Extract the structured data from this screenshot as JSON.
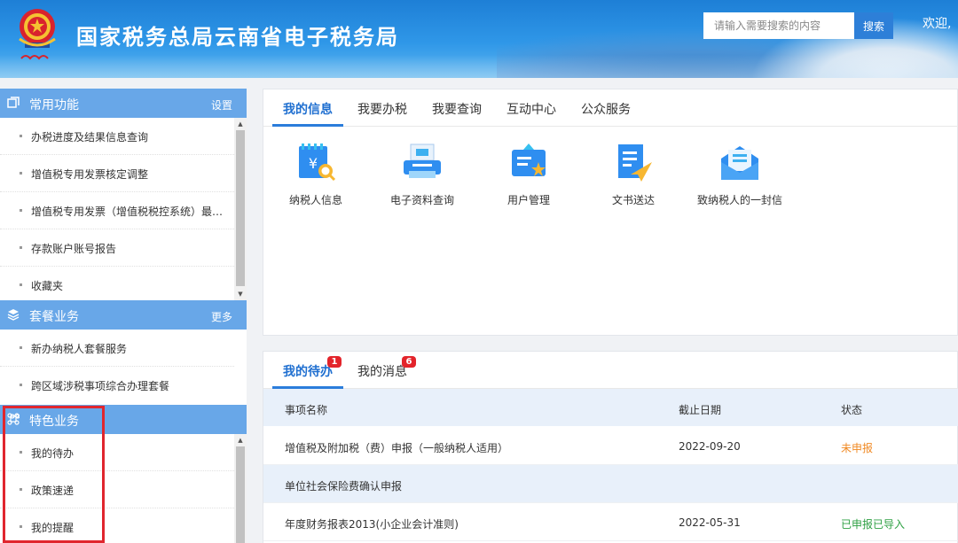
{
  "header": {
    "site_title": "国家税务总局云南省电子税务局",
    "search_placeholder": "请输入需要搜索的内容",
    "search_button": "搜索",
    "welcome_text": "欢迎,"
  },
  "sidebar": {
    "sections": [
      {
        "title": "常用功能",
        "action": "设置",
        "icon": "copy-icon",
        "items": [
          "办税进度及结果信息查询",
          "增值税专用发票核定调整",
          "增值税专用发票（增值税税控系统）最高开票限额申请",
          "存款账户账号报告",
          "收藏夹"
        ]
      },
      {
        "title": "套餐业务",
        "action": "更多",
        "icon": "layers-icon",
        "items": [
          "新办纳税人套餐服务",
          "跨区域涉税事项综合办理套餐"
        ]
      },
      {
        "title": "特色业务",
        "action": "",
        "icon": "command-icon",
        "items": [
          "我的待办",
          "政策速递",
          "我的提醒"
        ]
      }
    ]
  },
  "main_tabs": [
    "我的信息",
    "我要办税",
    "我要查询",
    "互动中心",
    "公众服务"
  ],
  "apps": [
    {
      "label": "纳税人信息",
      "icon": "taxpayer-info-icon"
    },
    {
      "label": "电子资料查询",
      "icon": "e-document-query-icon"
    },
    {
      "label": "用户管理",
      "icon": "user-management-icon"
    },
    {
      "label": "文书送达",
      "icon": "document-delivery-icon"
    },
    {
      "label": "致纳税人的一封信",
      "icon": "letter-icon"
    }
  ],
  "todo": {
    "tabs": [
      {
        "label": "我的待办",
        "badge": "1"
      },
      {
        "label": "我的消息",
        "badge": "6"
      }
    ],
    "columns": [
      "事项名称",
      "截止日期",
      "状态"
    ],
    "rows": [
      {
        "name": "增值税及附加税（费）申报（一般纳税人适用）",
        "date": "2022-09-20",
        "status": "未申报",
        "status_color": "#f08a24"
      },
      {
        "name": "单位社会保险费确认申报",
        "date": "",
        "status": "",
        "status_color": ""
      },
      {
        "name": "年度财务报表2013(小企业会计准则)",
        "date": "2022-05-31",
        "status": "已申报已导入",
        "status_color": "#2ea043"
      }
    ]
  },
  "colors": {
    "accent": "#2b7ddb",
    "sidebar_header": "#68a7e8",
    "highlight_box": "#e0262e"
  }
}
